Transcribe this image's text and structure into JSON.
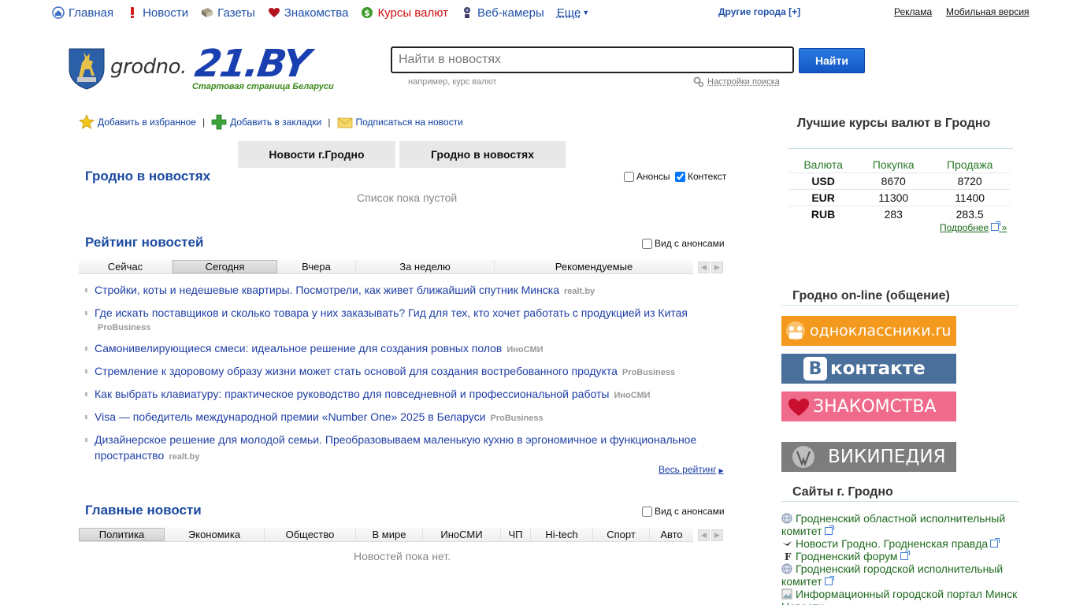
{
  "topnav": {
    "items": [
      {
        "label": "Главная",
        "icon": "home-icon"
      },
      {
        "label": "Новости",
        "icon": "exclamation-icon"
      },
      {
        "label": "Газеты",
        "icon": "newspaper-icon"
      },
      {
        "label": "Знакомства",
        "icon": "heart-icon"
      },
      {
        "label": "Курсы валют",
        "icon": "dollar-icon"
      },
      {
        "label": "Веб-камеры",
        "icon": "webcam-icon"
      }
    ],
    "more": "Еще",
    "other_cities": "Другие города [+]",
    "ads": "Реклама",
    "mobile": "Мобильная версия"
  },
  "header": {
    "brand_city": "grodno.",
    "brand_logo": "21.BY",
    "slogan": "Стартовая страница Беларуси",
    "search_placeholder": "Найти в новостях",
    "search_button": "Найти",
    "search_hint": "например, курс валют",
    "search_settings": "Настройки поиска"
  },
  "toolbar": {
    "favorites": "Добавить в избранное",
    "bookmarks": "Добавить в закладки",
    "subscribe": "Подписаться на новости"
  },
  "main_tabs": [
    "Новости г.Гродно",
    "Гродно в новостях"
  ],
  "city_in_news": {
    "title": "Гродно в новостях",
    "opt_announces": "Анонсы",
    "opt_context": "Контекст",
    "empty": "Список пока пустой"
  },
  "rating": {
    "title": "Рейтинг новостей",
    "opt_announces": "Вид с анонсами",
    "tabs": [
      "Сейчас",
      "Сегодня",
      "Вчера",
      "За неделю",
      "Рекомендуемые"
    ],
    "active_tab": "Сегодня",
    "items": [
      {
        "title": "Стройки, коты и недешевые квартиры. Посмотрели, как живет ближайший спутник Минска",
        "source": "realt.by"
      },
      {
        "title": "Где искать поставщиков и сколько товара у них заказывать? Гид для тех, кто хочет работать с продукцией из Китая",
        "source": "ProBusiness"
      },
      {
        "title": "Самонивелирующиеся смеси: идеальное решение для создания ровных полов",
        "source": "ИноСМИ"
      },
      {
        "title": "Стремление к здоровому образу жизни может стать основой для создания востребованного продукта",
        "source": "ProBusiness"
      },
      {
        "title": "Как выбрать клавиатуру: практическое руководство для повседневной и профессиональной работы",
        "source": "ИноСМИ"
      },
      {
        "title": "Visa — победитель международной премии «Number One» 2025 в Беларуси",
        "source": "ProBusiness"
      },
      {
        "title": "Дизайнерское решение для молодой семьи. Преобразовываем маленькую кухню в эргономичное и функциональное пространство",
        "source": "realt.by"
      }
    ],
    "all_link": "Весь рейтинг"
  },
  "main_news": {
    "title": "Главные новости",
    "opt_announces": "Вид с анонсами",
    "tabs": [
      "Политика",
      "Экономика",
      "Общество",
      "В мире",
      "ИноСМИ",
      "ЧП",
      "Hi-tech",
      "Спорт",
      "Авто"
    ],
    "active_tab": "Политика",
    "empty": "Новостей пока нет."
  },
  "currency": {
    "title": "Лучшие курсы валют в Гродно",
    "headers": [
      "Валюта",
      "Покупка",
      "Продажа"
    ],
    "rows": [
      [
        "USD",
        "8670",
        "8720"
      ],
      [
        "EUR",
        "11300",
        "11400"
      ],
      [
        "RUB",
        "283",
        "283.5"
      ]
    ],
    "more": "Подробнее",
    "more_arrow": "»"
  },
  "online": {
    "title": "Гродно on-line (общение)",
    "banners": [
      {
        "label": "одноклассники.ru",
        "color": "#f39a1e",
        "icon": "odnoklassniki-icon"
      },
      {
        "label": "контакте",
        "color": "#4a6f9a",
        "icon": "vkontakte-icon"
      },
      {
        "label": "ЗНАКОМСТВА",
        "color": "#f06a8c",
        "icon": "heart-icon"
      },
      {
        "label": "ВИКИПЕДИЯ",
        "color": "#7d7d7d",
        "icon": "wikipedia-icon"
      }
    ],
    "vk_letter": "В"
  },
  "sites": {
    "title": "Сайты г. Гродно",
    "items": [
      {
        "label": "Гродненский областной исполнительный комитет",
        "icon": "globe-icon"
      },
      {
        "label": "Новости Гродно. Гродненская правда",
        "icon": "bird-icon"
      },
      {
        "label": "Гродненский форум",
        "icon": "forum-icon"
      },
      {
        "label": "Гродненский городской исполнительный комитет",
        "icon": "globe-icon"
      },
      {
        "label": "Информационный городской портал Минск Новости",
        "icon": "image-icon"
      }
    ]
  }
}
